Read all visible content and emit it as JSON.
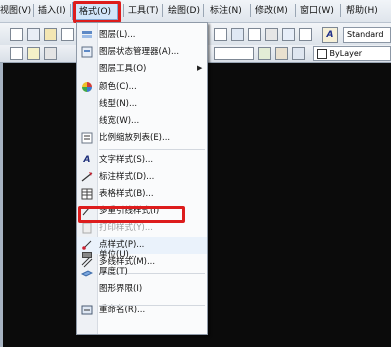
{
  "menubar": {
    "items": [
      {
        "label": "视图(V)"
      },
      {
        "label": "插入(I)"
      },
      {
        "label": "格式(O)"
      },
      {
        "label": "工具(T)"
      },
      {
        "label": "绘图(D)"
      },
      {
        "label": "标注(N)"
      },
      {
        "label": "修改(M)"
      },
      {
        "label": "窗口(W)"
      },
      {
        "label": "帮助(H)"
      }
    ]
  },
  "toolbar": {
    "text_style_value": "Standard",
    "layer_value": "ByLayer"
  },
  "format_menu": {
    "items": [
      {
        "label": "图层(L)...",
        "icon": "layer-icon"
      },
      {
        "label": "图层状态管理器(A)...",
        "icon": "layer-state-icon"
      },
      {
        "label": "图层工具(O)",
        "icon": "",
        "submenu": true
      },
      {
        "label": "颜色(C)...",
        "icon": "color-wheel-icon"
      },
      {
        "label": "线型(N)...",
        "icon": ""
      },
      {
        "label": "线宽(W)...",
        "icon": ""
      },
      {
        "label": "比例缩放列表(E)...",
        "icon": "scale-list-icon"
      },
      {
        "label": "文字样式(S)...",
        "icon": "text-style-icon"
      },
      {
        "label": "标注样式(D)...",
        "icon": "dim-style-icon"
      },
      {
        "label": "表格样式(B)...",
        "icon": "table-style-icon"
      },
      {
        "label": "多重引线样式(I)",
        "icon": "mleader-style-icon"
      },
      {
        "label": "打印样式(Y)...",
        "icon": "plot-style-icon",
        "disabled": true
      },
      {
        "label": "点样式(P)...",
        "icon": "point-style-icon",
        "highlighted": true
      },
      {
        "label": "多线样式(M)...",
        "icon": "mline-style-icon"
      },
      {
        "label": "单位(U)...",
        "icon": "units-icon"
      },
      {
        "label": "厚度(T)",
        "icon": "thickness-icon"
      },
      {
        "label": "图形界限(I)",
        "icon": ""
      },
      {
        "label": "重命名(R)...",
        "icon": "rename-icon"
      }
    ]
  }
}
